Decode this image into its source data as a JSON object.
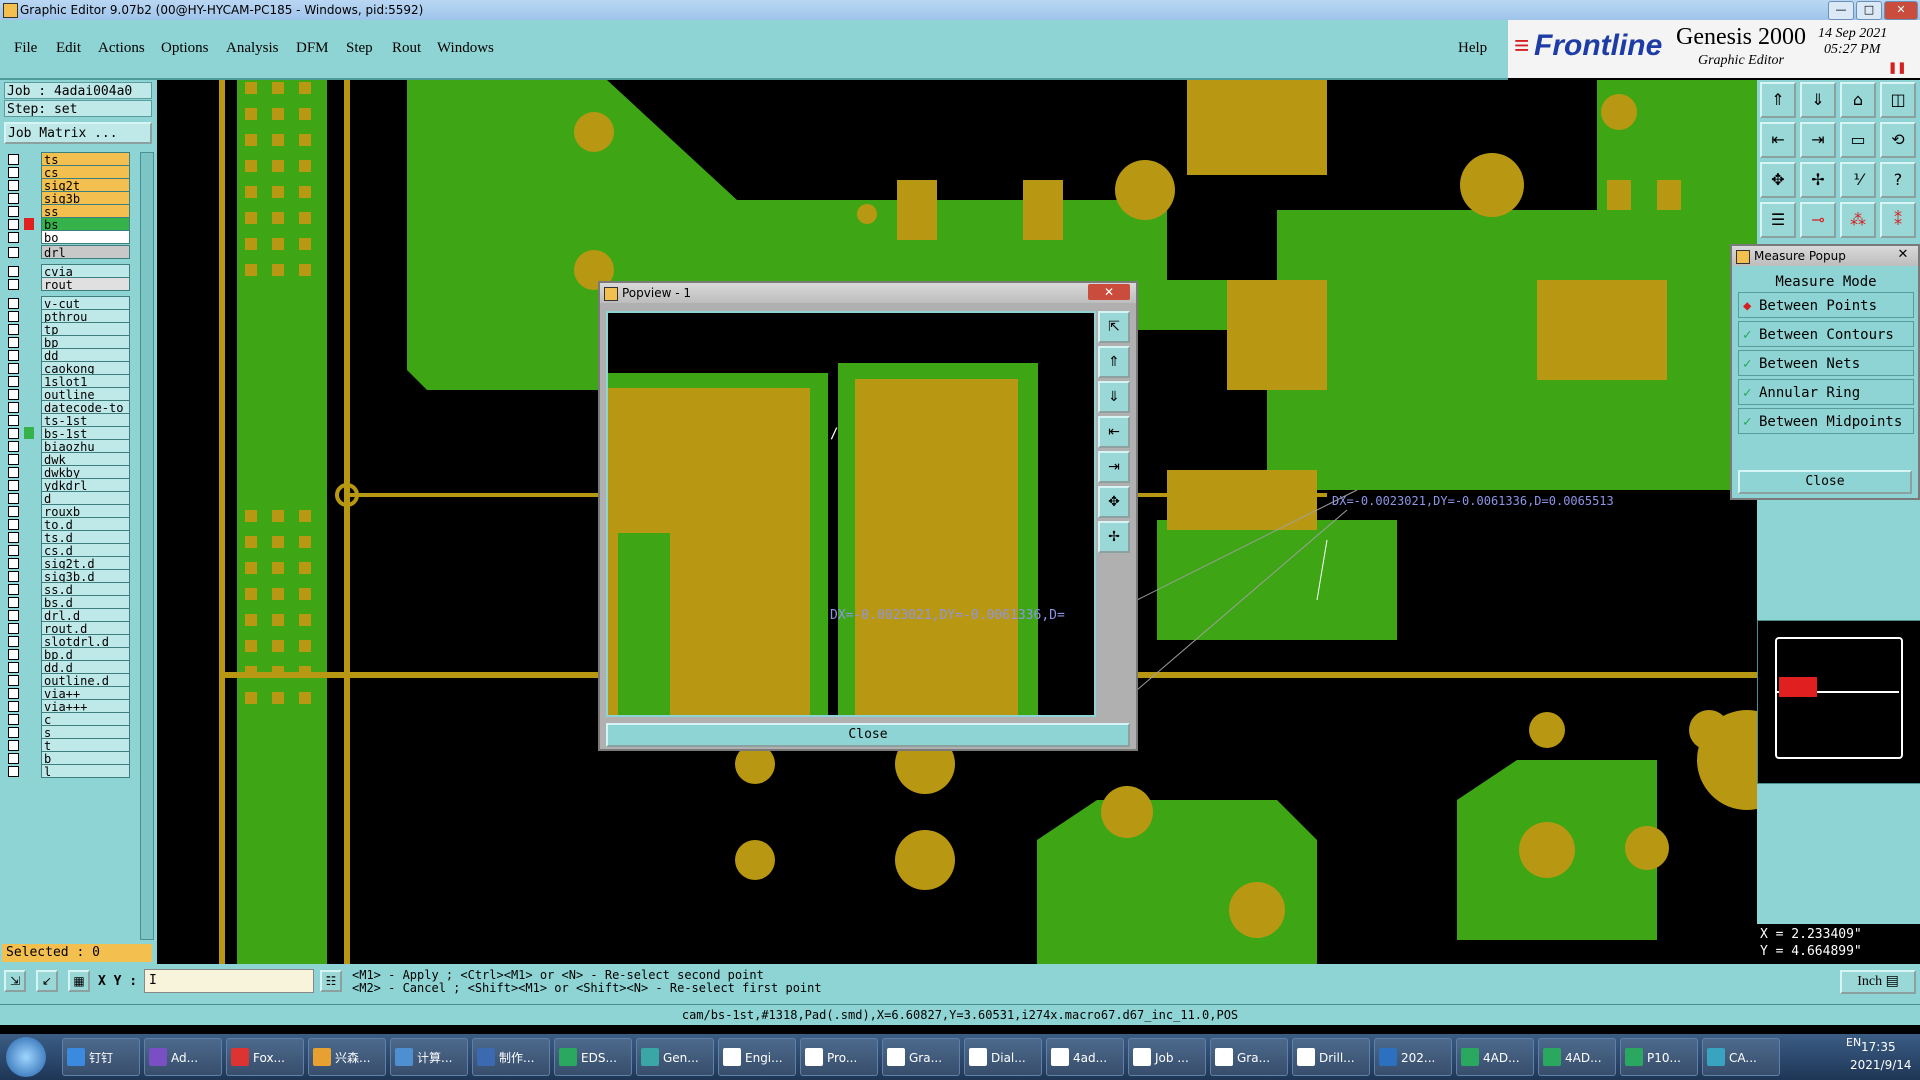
{
  "window": {
    "title": "Graphic Editor 9.07b2 (00@HY-HYCAM-PC185 - Windows, pid:5592)"
  },
  "menu": {
    "items": [
      "File",
      "Edit",
      "Actions",
      "Options",
      "Analysis",
      "DFM",
      "Step",
      "Rout",
      "Windows"
    ],
    "help": "Help"
  },
  "brand": {
    "logo": "Frontline",
    "product": "Genesis 2000",
    "subtitle": "Graphic Editor",
    "date": "14 Sep 2021",
    "time": "05:27 PM"
  },
  "job": {
    "job_line": "Job : 4adai004a0",
    "step_line": "Step: set",
    "matrix_button": "Job Matrix ..."
  },
  "layers": [
    {
      "name": "ts",
      "color": "#f3c04f"
    },
    {
      "name": "cs",
      "color": "#f3c04f"
    },
    {
      "name": "sig2t",
      "color": "#f3c04f"
    },
    {
      "name": "sig3b",
      "color": "#f3c04f"
    },
    {
      "name": "ss",
      "color": "#f3c04f"
    },
    {
      "name": "bs",
      "color": "#36b24a",
      "mark": "#e02020"
    },
    {
      "name": "bo",
      "color": "#ffffff"
    },
    {
      "name": "drl",
      "color": "#c8c8c8"
    },
    {
      "name": "cvia",
      "color": "#bfe8e8"
    },
    {
      "name": "rout",
      "color": "#e0e0e0"
    },
    {
      "name": "v-cut"
    },
    {
      "name": "pthrou"
    },
    {
      "name": "tp"
    },
    {
      "name": "bp"
    },
    {
      "name": "dd"
    },
    {
      "name": "caokong"
    },
    {
      "name": "1slot1"
    },
    {
      "name": "outline"
    },
    {
      "name": "datecode-to"
    },
    {
      "name": "ts-1st"
    },
    {
      "name": "bs-1st",
      "mark": "#36b24a",
      "selected": true
    },
    {
      "name": "biaozhu"
    },
    {
      "name": "dwk"
    },
    {
      "name": "dwkby"
    },
    {
      "name": "ydkdrl"
    },
    {
      "name": "d"
    },
    {
      "name": "rouxb"
    },
    {
      "name": "to.d"
    },
    {
      "name": "ts.d"
    },
    {
      "name": "cs.d"
    },
    {
      "name": "sig2t.d"
    },
    {
      "name": "sig3b.d"
    },
    {
      "name": "ss.d"
    },
    {
      "name": "bs.d"
    },
    {
      "name": "drl.d"
    },
    {
      "name": "rout.d"
    },
    {
      "name": "slotdrl.d"
    },
    {
      "name": "bp.d"
    },
    {
      "name": "dd.d"
    },
    {
      "name": "outline.d"
    },
    {
      "name": "via++"
    },
    {
      "name": "via+++"
    },
    {
      "name": "c"
    },
    {
      "name": "s"
    },
    {
      "name": "t"
    },
    {
      "name": "b"
    },
    {
      "name": "l"
    }
  ],
  "selected": "Selected : 0",
  "popview": {
    "title": "Popview - 1",
    "measure_text": "DX=-0.0023021,DY=-0.0061336,D=",
    "close": "Close"
  },
  "canvas": {
    "measure_text": "DX=-0.0023021,DY=-0.0061336,D=0.0065513"
  },
  "measure_popup": {
    "title": "Measure Popup",
    "mode_label": "Measure Mode",
    "options": [
      "Between Points",
      "Between Contours",
      "Between Nets",
      "Annular Ring",
      "Between Midpoints"
    ],
    "selected_index": 0,
    "close": "Close"
  },
  "coords": {
    "x": "X = 2.233409\"",
    "y": "Y = 4.664899\""
  },
  "input": {
    "label": "X Y :",
    "value": "I"
  },
  "hints": {
    "line1": "<M1> - Apply  ; <Ctrl><M1> or <N> - Re-select second point",
    "line2": "<M2> - Cancel ; <Shift><M1> or <Shift><N> - Re-select first point"
  },
  "unit": "Inch",
  "status_line": "cam/bs-1st,#1318,Pad(.smd),X=6.60827,Y=3.60531,i274x.macro67.d67_inc_11.0,POS",
  "taskbar": {
    "items": [
      "钉钉",
      "Ad...",
      "Fox...",
      "兴森...",
      "计算...",
      "制作...",
      "EDS...",
      "Gen...",
      "Engi...",
      "Pro...",
      "Gra...",
      "Dial...",
      "4ad...",
      "Job ...",
      "Gra...",
      "Drill...",
      "202...",
      "4AD...",
      "4AD...",
      "P10...",
      "CA..."
    ],
    "tray_lang": "EN",
    "clock_time": "17:35",
    "clock_date": "2021/9/14"
  },
  "colors": {
    "copper": "#b89812",
    "green": "#3ea515",
    "panel": "#8fd4d4",
    "trace": "#b89812"
  }
}
